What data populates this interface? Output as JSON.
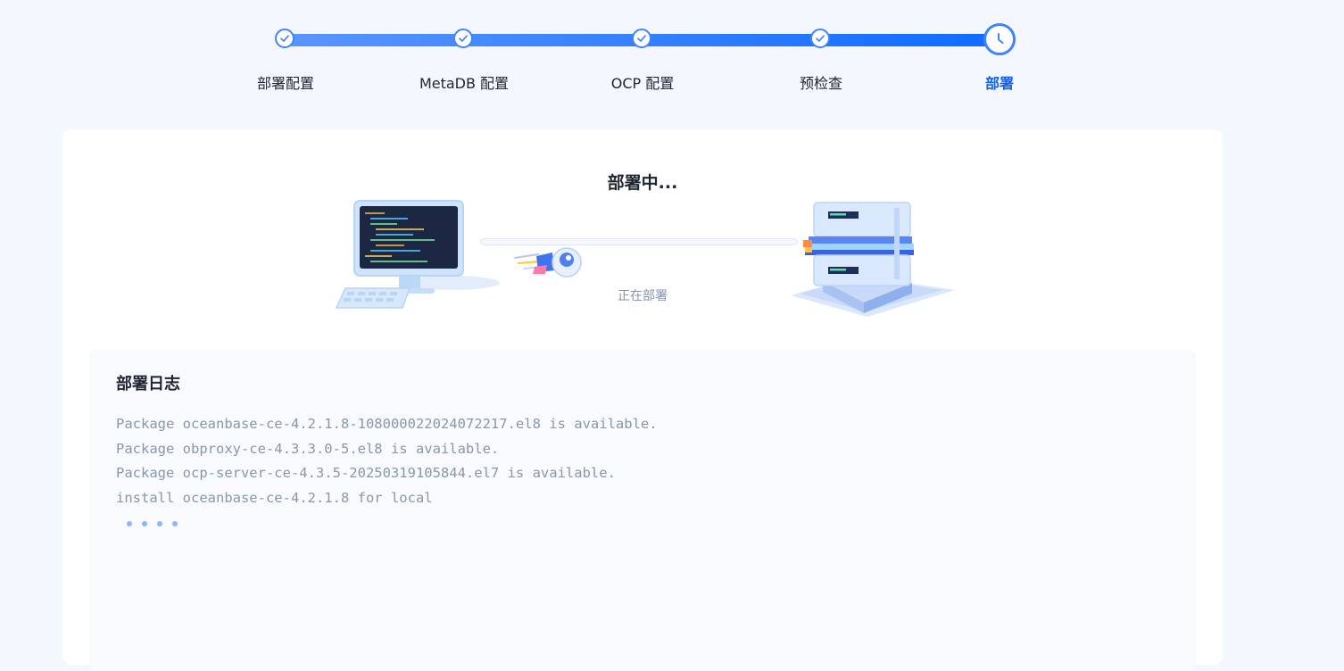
{
  "stepper": {
    "steps": [
      {
        "label": "部署配置",
        "status": "done"
      },
      {
        "label": "MetaDB 配置",
        "status": "done"
      },
      {
        "label": "OCP 配置",
        "status": "done"
      },
      {
        "label": "预检查",
        "status": "done"
      },
      {
        "label": "部署",
        "status": "current"
      }
    ]
  },
  "deploy": {
    "title": "部署中...",
    "status": "正在部署",
    "progress": 0
  },
  "log": {
    "title": "部署日志",
    "lines": [
      "Package oceanbase-ce-4.2.1.8-108000022024072217.el8 is available.",
      "Package obproxy-ce-4.3.3.0-5.el8 is available.",
      "Package ocp-server-ce-4.3.5-20250319105844.el7 is available.",
      "install oceanbase-ce-4.2.1.8 for local"
    ]
  },
  "colors": {
    "accent": "#1660e8",
    "track_start": "#5a95ff",
    "track_end": "#0f6bff",
    "background": "#f4f7fd"
  },
  "icons": {
    "step_done": "check-icon",
    "step_current": "clock-icon"
  }
}
